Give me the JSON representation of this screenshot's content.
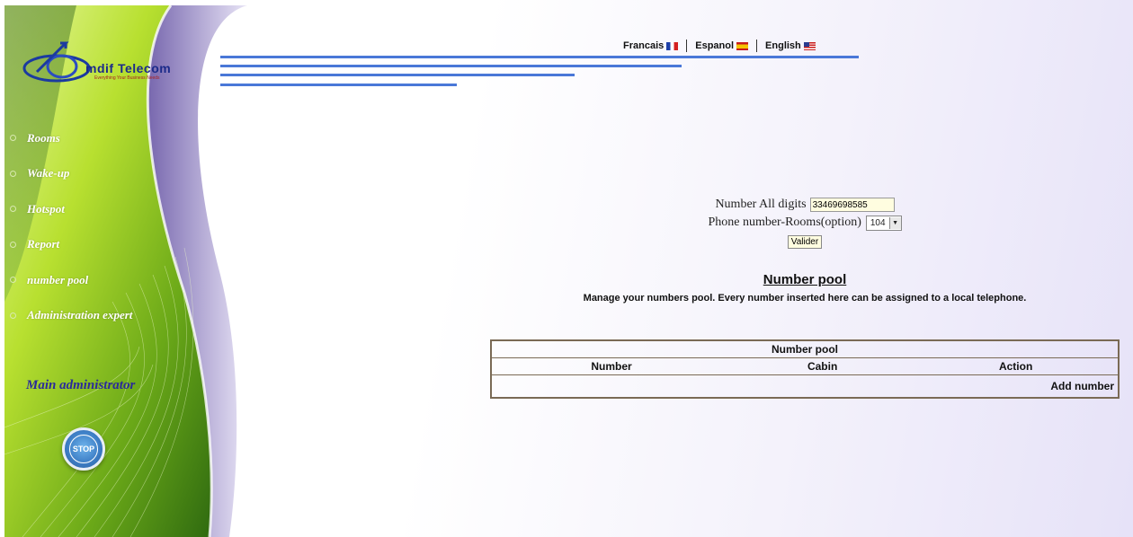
{
  "logo": {
    "text": "mdif Telecom",
    "tagline": "Everything Your Business Needs"
  },
  "languages": [
    {
      "label": "Francais",
      "flag": "fr-flag-icon"
    },
    {
      "label": "Espanol",
      "flag": "es-flag-icon"
    },
    {
      "label": "English",
      "flag": "us-flag-icon"
    }
  ],
  "nav": {
    "items": [
      {
        "label": "Rooms"
      },
      {
        "label": "Wake-up"
      },
      {
        "label": "Hotspot"
      },
      {
        "label": "Report"
      },
      {
        "label": "number pool"
      },
      {
        "label": "Administration expert"
      }
    ]
  },
  "sidebar": {
    "admin_label": "Main administrator",
    "stop_label": "STOP"
  },
  "form": {
    "number_label": "Number All digits",
    "number_value": "33469698585",
    "room_label": "Phone number-Rooms(option)",
    "room_value": "104",
    "submit_label": "Valider"
  },
  "page": {
    "title": "Number pool",
    "description": "Manage your numbers pool. Every number inserted here can be assigned to a local telephone."
  },
  "table": {
    "caption": "Number pool",
    "columns": [
      "Number",
      "Cabin",
      "Action"
    ],
    "add_label": "Add number"
  },
  "colors": {
    "accent_bar": "#4a78d8",
    "sidebar_green": "#a8d820",
    "sidebar_purple": "#5a4a8a",
    "table_border": "#7a6a55"
  }
}
